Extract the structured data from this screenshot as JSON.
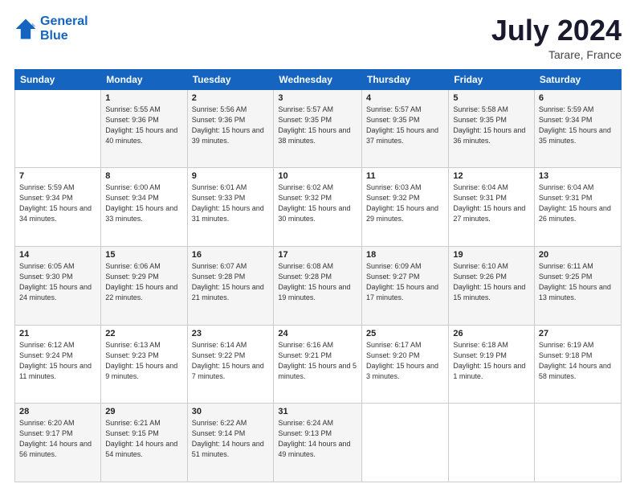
{
  "logo": {
    "line1": "General",
    "line2": "Blue"
  },
  "title": "July 2024",
  "subtitle": "Tarare, France",
  "days_header": [
    "Sunday",
    "Monday",
    "Tuesday",
    "Wednesday",
    "Thursday",
    "Friday",
    "Saturday"
  ],
  "weeks": [
    [
      {
        "day": "",
        "content": ""
      },
      {
        "day": "1",
        "content": "Sunrise: 5:55 AM\nSunset: 9:36 PM\nDaylight: 15 hours\nand 40 minutes."
      },
      {
        "day": "2",
        "content": "Sunrise: 5:56 AM\nSunset: 9:36 PM\nDaylight: 15 hours\nand 39 minutes."
      },
      {
        "day": "3",
        "content": "Sunrise: 5:57 AM\nSunset: 9:35 PM\nDaylight: 15 hours\nand 38 minutes."
      },
      {
        "day": "4",
        "content": "Sunrise: 5:57 AM\nSunset: 9:35 PM\nDaylight: 15 hours\nand 37 minutes."
      },
      {
        "day": "5",
        "content": "Sunrise: 5:58 AM\nSunset: 9:35 PM\nDaylight: 15 hours\nand 36 minutes."
      },
      {
        "day": "6",
        "content": "Sunrise: 5:59 AM\nSunset: 9:34 PM\nDaylight: 15 hours\nand 35 minutes."
      }
    ],
    [
      {
        "day": "7",
        "content": "Sunrise: 5:59 AM\nSunset: 9:34 PM\nDaylight: 15 hours\nand 34 minutes."
      },
      {
        "day": "8",
        "content": "Sunrise: 6:00 AM\nSunset: 9:34 PM\nDaylight: 15 hours\nand 33 minutes."
      },
      {
        "day": "9",
        "content": "Sunrise: 6:01 AM\nSunset: 9:33 PM\nDaylight: 15 hours\nand 31 minutes."
      },
      {
        "day": "10",
        "content": "Sunrise: 6:02 AM\nSunset: 9:32 PM\nDaylight: 15 hours\nand 30 minutes."
      },
      {
        "day": "11",
        "content": "Sunrise: 6:03 AM\nSunset: 9:32 PM\nDaylight: 15 hours\nand 29 minutes."
      },
      {
        "day": "12",
        "content": "Sunrise: 6:04 AM\nSunset: 9:31 PM\nDaylight: 15 hours\nand 27 minutes."
      },
      {
        "day": "13",
        "content": "Sunrise: 6:04 AM\nSunset: 9:31 PM\nDaylight: 15 hours\nand 26 minutes."
      }
    ],
    [
      {
        "day": "14",
        "content": "Sunrise: 6:05 AM\nSunset: 9:30 PM\nDaylight: 15 hours\nand 24 minutes."
      },
      {
        "day": "15",
        "content": "Sunrise: 6:06 AM\nSunset: 9:29 PM\nDaylight: 15 hours\nand 22 minutes."
      },
      {
        "day": "16",
        "content": "Sunrise: 6:07 AM\nSunset: 9:28 PM\nDaylight: 15 hours\nand 21 minutes."
      },
      {
        "day": "17",
        "content": "Sunrise: 6:08 AM\nSunset: 9:28 PM\nDaylight: 15 hours\nand 19 minutes."
      },
      {
        "day": "18",
        "content": "Sunrise: 6:09 AM\nSunset: 9:27 PM\nDaylight: 15 hours\nand 17 minutes."
      },
      {
        "day": "19",
        "content": "Sunrise: 6:10 AM\nSunset: 9:26 PM\nDaylight: 15 hours\nand 15 minutes."
      },
      {
        "day": "20",
        "content": "Sunrise: 6:11 AM\nSunset: 9:25 PM\nDaylight: 15 hours\nand 13 minutes."
      }
    ],
    [
      {
        "day": "21",
        "content": "Sunrise: 6:12 AM\nSunset: 9:24 PM\nDaylight: 15 hours\nand 11 minutes."
      },
      {
        "day": "22",
        "content": "Sunrise: 6:13 AM\nSunset: 9:23 PM\nDaylight: 15 hours\nand 9 minutes."
      },
      {
        "day": "23",
        "content": "Sunrise: 6:14 AM\nSunset: 9:22 PM\nDaylight: 15 hours\nand 7 minutes."
      },
      {
        "day": "24",
        "content": "Sunrise: 6:16 AM\nSunset: 9:21 PM\nDaylight: 15 hours\nand 5 minutes."
      },
      {
        "day": "25",
        "content": "Sunrise: 6:17 AM\nSunset: 9:20 PM\nDaylight: 15 hours\nand 3 minutes."
      },
      {
        "day": "26",
        "content": "Sunrise: 6:18 AM\nSunset: 9:19 PM\nDaylight: 15 hours\nand 1 minute."
      },
      {
        "day": "27",
        "content": "Sunrise: 6:19 AM\nSunset: 9:18 PM\nDaylight: 14 hours\nand 58 minutes."
      }
    ],
    [
      {
        "day": "28",
        "content": "Sunrise: 6:20 AM\nSunset: 9:17 PM\nDaylight: 14 hours\nand 56 minutes."
      },
      {
        "day": "29",
        "content": "Sunrise: 6:21 AM\nSunset: 9:15 PM\nDaylight: 14 hours\nand 54 minutes."
      },
      {
        "day": "30",
        "content": "Sunrise: 6:22 AM\nSunset: 9:14 PM\nDaylight: 14 hours\nand 51 minutes."
      },
      {
        "day": "31",
        "content": "Sunrise: 6:24 AM\nSunset: 9:13 PM\nDaylight: 14 hours\nand 49 minutes."
      },
      {
        "day": "",
        "content": ""
      },
      {
        "day": "",
        "content": ""
      },
      {
        "day": "",
        "content": ""
      }
    ]
  ]
}
